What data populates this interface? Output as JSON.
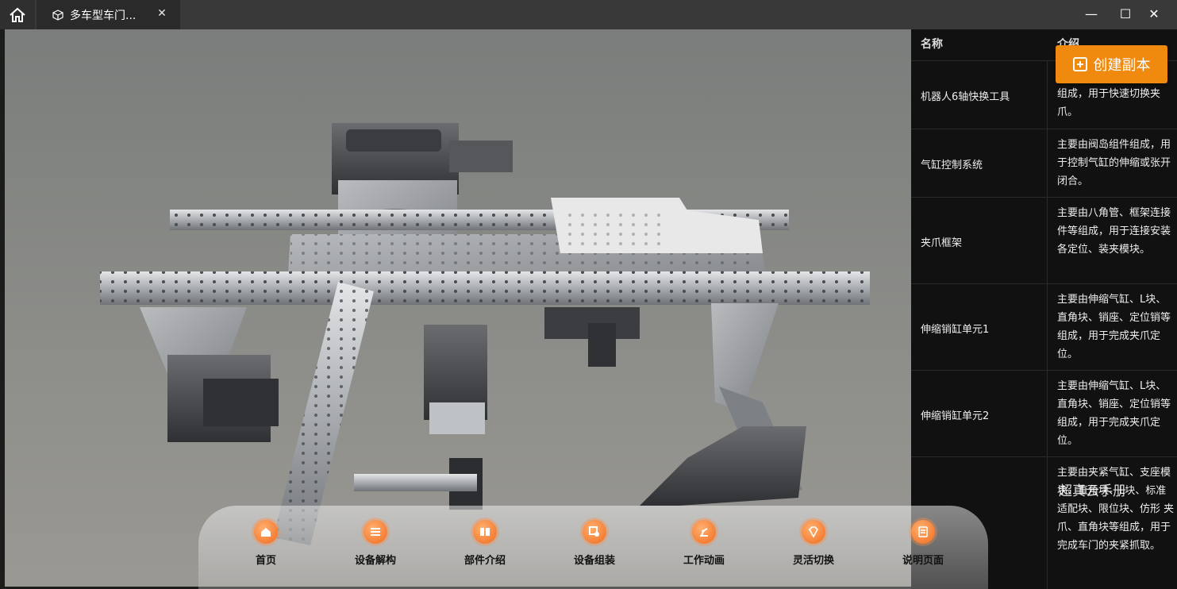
{
  "window": {
    "tab_title": "多车型车门...",
    "close_glyph": "✕",
    "minimize_glyph": "—",
    "maximize_glyph": "☐"
  },
  "panel": {
    "col_name": "名称",
    "col_desc": "介绍",
    "rows": [
      {
        "name": "机器人6轴快换工具",
        "desc": "组成，用于快速切换夹爪。"
      },
      {
        "name": "气缸控制系统",
        "desc": "主要由阀岛组件组成，用于控制气缸的伸缩或张开闭合。"
      },
      {
        "name": "夹爪框架",
        "desc": "主要由八角管、框架连接件等组成，用于连接安装各定位、装夹模块。"
      },
      {
        "name": "伸缩销缸单元1",
        "desc": "主要由伸缩气缸、L块、直角块、销座、定位销等组成，用于完成夹爪定位。"
      },
      {
        "name": "伸缩销缸单元2",
        "desc": "主要由伸缩气缸、L块、直角块、销座、定位销等组成，用于完成夹爪定位。"
      },
      {
        "name": "",
        "desc": "主要由夹紧气缸、支座模块、直角块、L块、标准适配块、限位块、仿形 夹爪、直角块等组成，用于完成车门的夹紧抓取。"
      }
    ]
  },
  "create_copy_label": "创建副本",
  "overlay_text": "超真云手册",
  "dock": {
    "items": [
      {
        "label": "首页",
        "icon": "home-icon"
      },
      {
        "label": "设备解构",
        "icon": "list-icon"
      },
      {
        "label": "部件介绍",
        "icon": "book-icon"
      },
      {
        "label": "设备组装",
        "icon": "assembly-icon"
      },
      {
        "label": "工作动画",
        "icon": "robot-arm-icon"
      },
      {
        "label": "灵活切换",
        "icon": "diamond-icon"
      },
      {
        "label": "说明页面",
        "icon": "document-icon"
      }
    ]
  },
  "colors": {
    "accent": "#ef8a0f",
    "icon_orange": "#f06a1c",
    "panel_bg": "#111111",
    "titlebar_bg": "#393939"
  }
}
